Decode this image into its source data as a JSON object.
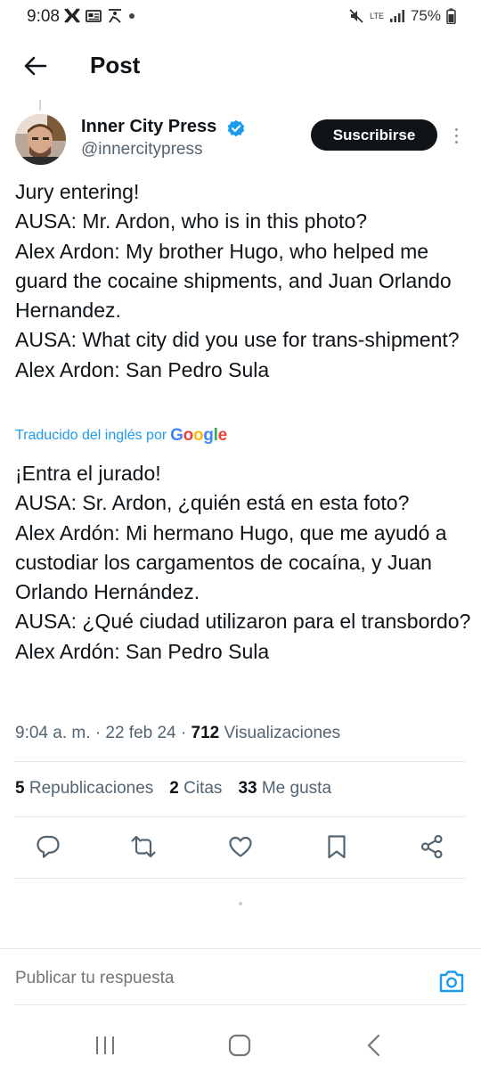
{
  "status_bar": {
    "time": "9:08",
    "network": "LTE",
    "battery": "75%",
    "left_icons": [
      "x-logo-icon",
      "news-icon",
      "person-running-icon",
      "dot-icon"
    ],
    "right_icons": [
      "mute-icon",
      "signal-icon",
      "battery-icon"
    ]
  },
  "header": {
    "title": "Post",
    "back_icon": "arrow-left-icon"
  },
  "post": {
    "author_name": "Inner City Press",
    "handle": "@innercitypress",
    "subscribe_label": "Suscribirse",
    "text": "Jury entering!\nAUSA: Mr. Ardon, who is in this photo?\nAlex Ardon: My brother Hugo, who helped me guard the cocaine shipments, and Juan Orlando Hernandez.\nAUSA: What city did you use for trans-shipment?\nAlex Ardon: San Pedro Sula",
    "translated_note": "Traducido del inglés por",
    "translator": "Google",
    "translation": "¡Entra el jurado!\nAUSA: Sr. Ardon, ¿quién está en esta foto?\nAlex Ardón: Mi hermano Hugo, que me ayudó a custodiar los cargamentos de cocaína, y Juan Orlando Hernández.\nAUSA: ¿Qué ciudad utilizaron para el transbordo?\nAlex Ardón: San Pedro Sula",
    "timestamp": "9:04 a. m. · 22 feb 24 · ",
    "views_count": "712",
    "views_label": " Visualizaciones"
  },
  "stats": {
    "reposts_count": "5",
    "reposts_label": "Republicaciones",
    "quotes_count": "2",
    "quotes_label": "Citas",
    "likes_count": "33",
    "likes_label": "Me gusta"
  },
  "actions": [
    "reply-icon",
    "repost-icon",
    "like-icon",
    "bookmark-icon",
    "share-icon"
  ],
  "reply": {
    "placeholder": "Publicar tu respuesta"
  },
  "colors": {
    "accent": "#1d9bf0",
    "text": "#0f1419",
    "secondary": "#536471",
    "verified": "#1d9bf0"
  }
}
